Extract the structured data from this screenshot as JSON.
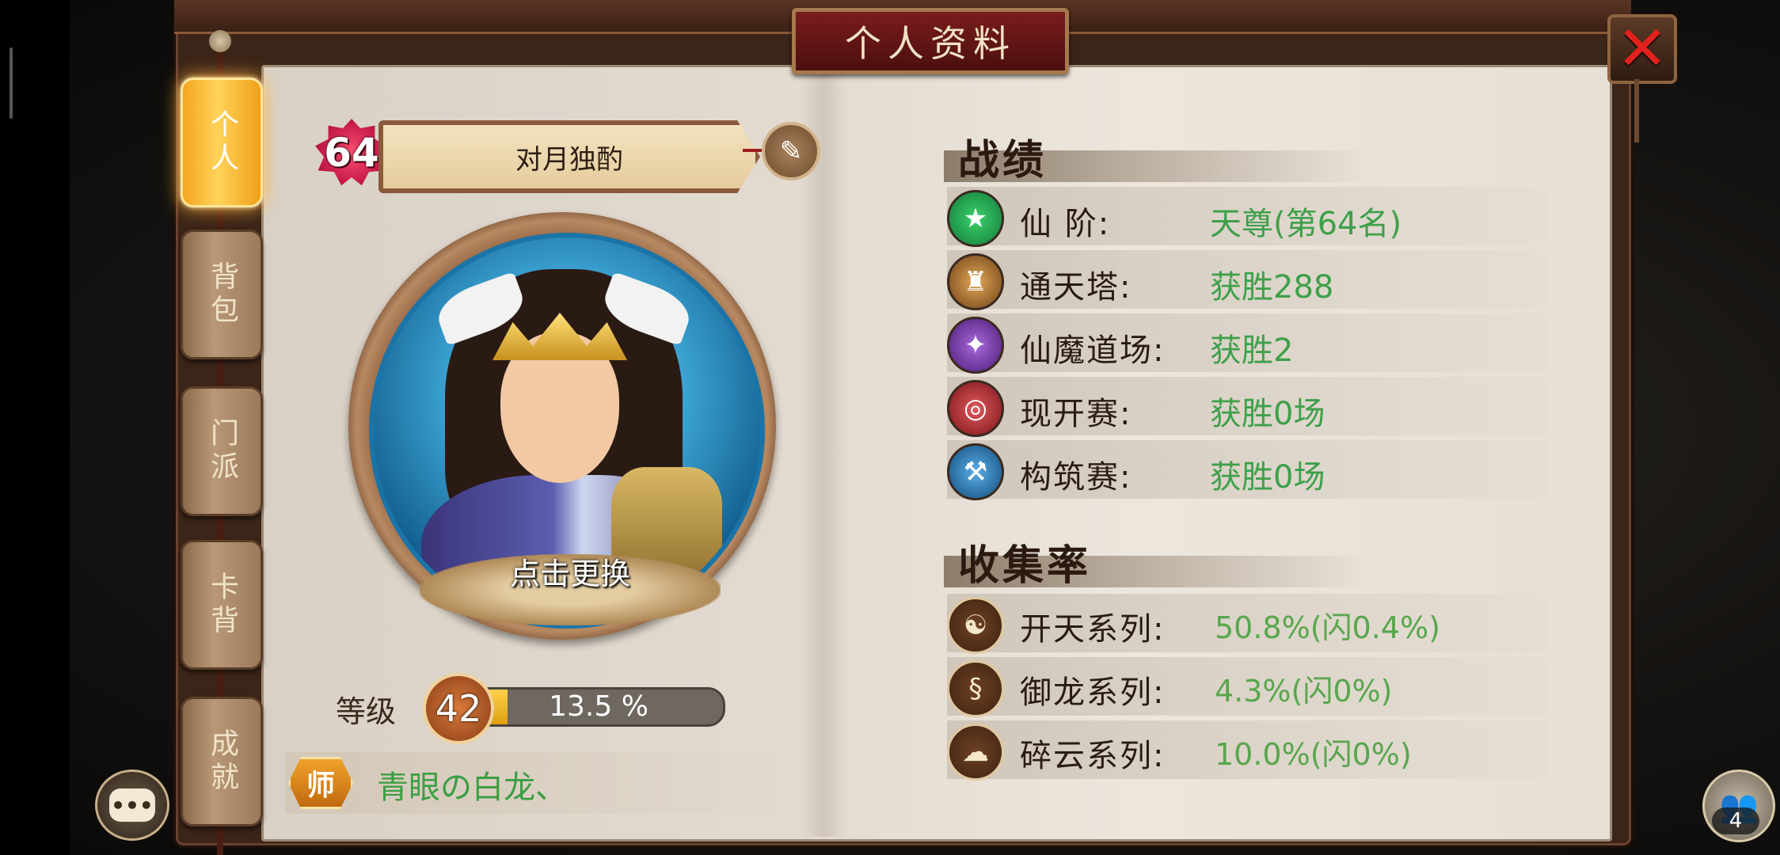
{
  "window": {
    "title": "个人资料",
    "close_icon": "close-icon"
  },
  "tabs": [
    {
      "label": "个人",
      "active": true
    },
    {
      "label": "背包",
      "active": false
    },
    {
      "label": "门派",
      "active": false
    },
    {
      "label": "卡背",
      "active": false
    },
    {
      "label": "成就",
      "active": false
    }
  ],
  "profile": {
    "level_badge": "64",
    "name": "对月独酌",
    "edit_icon": "edit-icon",
    "change_avatar_label": "点击更换",
    "level_label": "等级",
    "level": "42",
    "xp_text": "13.5 %",
    "xp_fraction": 0.135,
    "master_badge": "师",
    "master_name": "青眼の白龙、"
  },
  "record": {
    "title": "战绩",
    "rows": [
      {
        "label": "仙  阶:",
        "value": "天尊(第64名)",
        "icon": "star-icon",
        "color": "#1a9a4a"
      },
      {
        "label": "通天塔:",
        "value": "获胜288",
        "icon": "tower-icon",
        "color": "#8a5a20"
      },
      {
        "label": "仙魔道场:",
        "value": "获胜2",
        "icon": "demon-icon",
        "color": "#6a2c9a"
      },
      {
        "label": "现开赛:",
        "value": "获胜0场",
        "icon": "target-icon",
        "color": "#a0242a"
      },
      {
        "label": "构筑赛:",
        "value": "获胜0场",
        "icon": "build-icon",
        "color": "#1f6fae"
      }
    ]
  },
  "collection": {
    "title": "收集率",
    "rows": [
      {
        "label": "开天系列:",
        "value": "50.8%(闪0.4%)",
        "icon": "kaitian-icon"
      },
      {
        "label": "御龙系列:",
        "value": "4.3%(闪0%)",
        "icon": "dragon-icon"
      },
      {
        "label": "碎云系列:",
        "value": "10.0%(闪0%)",
        "icon": "cloud-icon"
      }
    ]
  },
  "footer": {
    "chat_icon": "chat-icon",
    "friends_icon": "friends-icon",
    "friends_count": "4"
  }
}
